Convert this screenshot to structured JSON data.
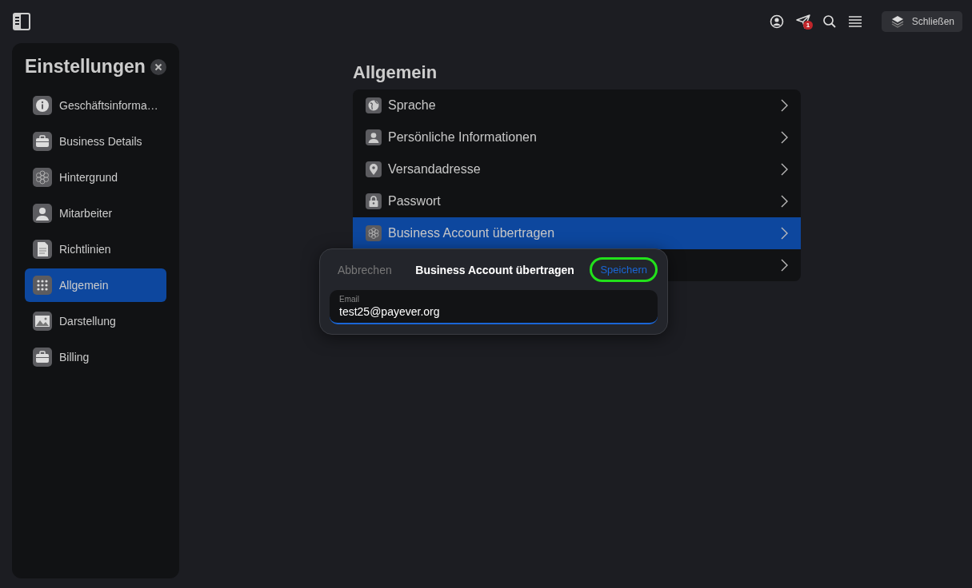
{
  "topbar": {
    "notification_count": "1",
    "close_label": "Schließen"
  },
  "sidebar": {
    "title": "Einstellungen",
    "items": [
      {
        "label": "Geschäftsinforma…",
        "kind": "info",
        "selected": false
      },
      {
        "label": "Business Details",
        "kind": "briefcase",
        "selected": false
      },
      {
        "label": "Hintergrund",
        "kind": "flower",
        "selected": false
      },
      {
        "label": "Mitarbeiter",
        "kind": "person",
        "selected": false
      },
      {
        "label": "Richtlinien",
        "kind": "document",
        "selected": false
      },
      {
        "label": "Allgemein",
        "kind": "grid",
        "selected": true
      },
      {
        "label": "Darstellung",
        "kind": "image",
        "selected": false
      },
      {
        "label": "Billing",
        "kind": "briefcase",
        "selected": false
      }
    ]
  },
  "main": {
    "title": "Allgemein",
    "rows": [
      {
        "label": "Sprache",
        "kind": "globe",
        "selected": false
      },
      {
        "label": "Persönliche Informationen",
        "kind": "person",
        "selected": false
      },
      {
        "label": "Versandadresse",
        "kind": "pin",
        "selected": false
      },
      {
        "label": "Passwort",
        "kind": "lock",
        "selected": false
      },
      {
        "label": "Business Account übertragen",
        "kind": "flower",
        "selected": true
      },
      {
        "kind": "none",
        "selected": false
      }
    ]
  },
  "dialog": {
    "cancel": "Abbrechen",
    "title": "Business Account übertragen",
    "save": "Speichern",
    "field_label": "Email",
    "field_value": "test25@payever.org"
  }
}
